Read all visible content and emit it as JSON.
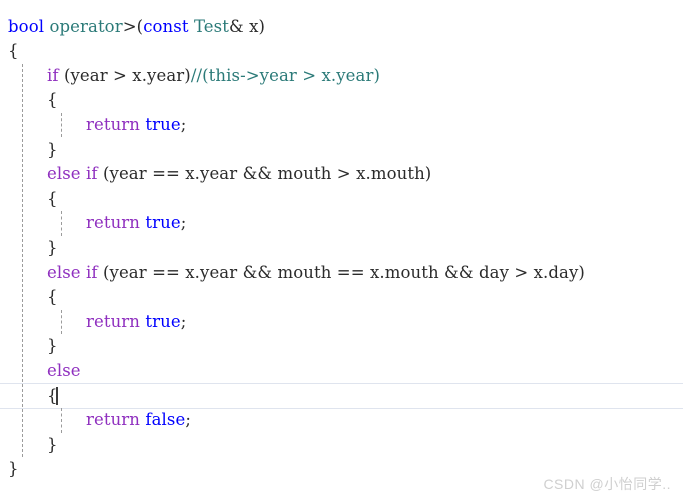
{
  "editor": {
    "language": "cpp",
    "background_color": "#ffffff",
    "current_line_number": 16,
    "colors": {
      "keyword": "#0000ff",
      "control": "#8f2fbf",
      "type": "#2b7a78",
      "comment": "#2b7a78",
      "plain": "#2b2b2b",
      "indent_guide": "#9b9b9b",
      "current_line_rule": "#dfe4ee",
      "caret": "#3b3b3b",
      "watermark": "#cfcfcf"
    },
    "lines": [
      {
        "n": 1,
        "indent": 0,
        "tokens": [
          {
            "text": "bool",
            "cls": "t-kw"
          },
          {
            "text": " ",
            "cls": "t-plain"
          },
          {
            "text": "operator",
            "cls": "t-type"
          },
          {
            "text": ">(",
            "cls": "t-plain"
          },
          {
            "text": "const",
            "cls": "t-kw"
          },
          {
            "text": " ",
            "cls": "t-plain"
          },
          {
            "text": "Test",
            "cls": "t-type"
          },
          {
            "text": "& x)",
            "cls": "t-plain"
          }
        ]
      },
      {
        "n": 2,
        "indent": 0,
        "tokens": [
          {
            "text": "{",
            "cls": "t-brace"
          }
        ]
      },
      {
        "n": 3,
        "indent": 1,
        "tokens": [
          {
            "text": "if",
            "cls": "t-ctrl"
          },
          {
            "text": " (year > x.year)",
            "cls": "t-plain"
          },
          {
            "text": "//(this->year > x.year)",
            "cls": "t-comment"
          }
        ]
      },
      {
        "n": 4,
        "indent": 1,
        "tokens": [
          {
            "text": "{",
            "cls": "t-brace"
          }
        ]
      },
      {
        "n": 5,
        "indent": 2,
        "tokens": [
          {
            "text": "return",
            "cls": "t-ctrl"
          },
          {
            "text": " ",
            "cls": "t-plain"
          },
          {
            "text": "true",
            "cls": "t-kw"
          },
          {
            "text": ";",
            "cls": "t-plain"
          }
        ]
      },
      {
        "n": 6,
        "indent": 1,
        "tokens": [
          {
            "text": "}",
            "cls": "t-brace"
          }
        ]
      },
      {
        "n": 7,
        "indent": 1,
        "tokens": [
          {
            "text": "else",
            "cls": "t-ctrl"
          },
          {
            "text": " ",
            "cls": "t-plain"
          },
          {
            "text": "if",
            "cls": "t-ctrl"
          },
          {
            "text": " (year == x.year && mouth > x.mouth)",
            "cls": "t-plain"
          }
        ]
      },
      {
        "n": 8,
        "indent": 1,
        "tokens": [
          {
            "text": "{",
            "cls": "t-brace"
          }
        ]
      },
      {
        "n": 9,
        "indent": 2,
        "tokens": [
          {
            "text": "return",
            "cls": "t-ctrl"
          },
          {
            "text": " ",
            "cls": "t-plain"
          },
          {
            "text": "true",
            "cls": "t-kw"
          },
          {
            "text": ";",
            "cls": "t-plain"
          }
        ]
      },
      {
        "n": 10,
        "indent": 1,
        "tokens": [
          {
            "text": "}",
            "cls": "t-brace"
          }
        ]
      },
      {
        "n": 11,
        "indent": 1,
        "tokens": [
          {
            "text": "else",
            "cls": "t-ctrl"
          },
          {
            "text": " ",
            "cls": "t-plain"
          },
          {
            "text": "if",
            "cls": "t-ctrl"
          },
          {
            "text": " (year == x.year && mouth == x.mouth && day > x.day)",
            "cls": "t-plain"
          }
        ]
      },
      {
        "n": 12,
        "indent": 1,
        "tokens": [
          {
            "text": "{",
            "cls": "t-brace"
          }
        ]
      },
      {
        "n": 13,
        "indent": 2,
        "tokens": [
          {
            "text": "return",
            "cls": "t-ctrl"
          },
          {
            "text": " ",
            "cls": "t-plain"
          },
          {
            "text": "true",
            "cls": "t-kw"
          },
          {
            "text": ";",
            "cls": "t-plain"
          }
        ]
      },
      {
        "n": 14,
        "indent": 1,
        "tokens": [
          {
            "text": "}",
            "cls": "t-brace"
          }
        ]
      },
      {
        "n": 15,
        "indent": 1,
        "tokens": [
          {
            "text": "else",
            "cls": "t-ctrl"
          }
        ]
      },
      {
        "n": 16,
        "indent": 1,
        "tokens": [
          {
            "text": "{",
            "cls": "t-brace"
          }
        ]
      },
      {
        "n": 17,
        "indent": 2,
        "tokens": [
          {
            "text": "return",
            "cls": "t-ctrl"
          },
          {
            "text": " ",
            "cls": "t-plain"
          },
          {
            "text": "false",
            "cls": "t-kw"
          },
          {
            "text": ";",
            "cls": "t-plain"
          }
        ]
      },
      {
        "n": 18,
        "indent": 1,
        "tokens": [
          {
            "text": "}",
            "cls": "t-brace"
          }
        ]
      },
      {
        "n": 19,
        "indent": 0,
        "tokens": [
          {
            "text": "}",
            "cls": "t-brace"
          }
        ]
      }
    ],
    "indent_guides": [
      {
        "indent": 0,
        "from_line": 3,
        "to_line": 19
      },
      {
        "indent": 1,
        "from_line": 5,
        "to_line": 6
      },
      {
        "indent": 1,
        "from_line": 9,
        "to_line": 10
      },
      {
        "indent": 1,
        "from_line": 13,
        "to_line": 14
      },
      {
        "indent": 1,
        "from_line": 17,
        "to_line": 18
      }
    ]
  },
  "watermark": {
    "text": "CSDN @小怡同学.."
  }
}
